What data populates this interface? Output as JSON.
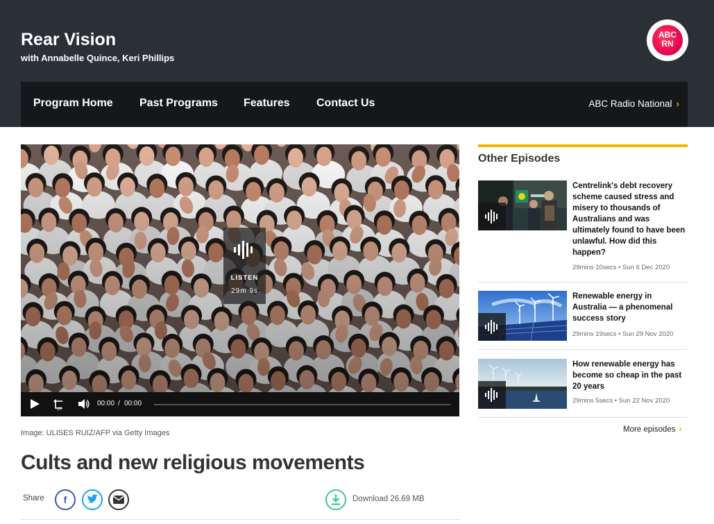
{
  "header": {
    "title": "Rear Vision",
    "hosts": "with Annabelle Quince, Keri Phillips",
    "logo_text": "ABC RN"
  },
  "nav": {
    "items": [
      "Program Home",
      "Past Programs",
      "Features",
      "Contact Us"
    ],
    "network": "ABC Radio National"
  },
  "player": {
    "listen_label": "LISTEN",
    "duration": "29m 9s",
    "current_time": "00:00",
    "separator": "/",
    "total_time": "00:00",
    "progress": 0
  },
  "episode": {
    "image_caption": "Image: ULISES RUIZ/AFP via Getty Images",
    "title": "Cults and new religious movements",
    "share_label": "Share",
    "download_label": "Download 26.69 MB"
  },
  "sidebar": {
    "title": "Other Episodes",
    "episodes": [
      {
        "title": "Centrelink's debt recovery scheme caused stress and misery to thousands of Australians and was ultimately found to have been unlawful. How did this happen?",
        "meta": "29mins 10secs • Sun 6 Dec 2020"
      },
      {
        "title": "Renewable energy in Australia — a phenomenal success story",
        "meta": "29mins 19secs • Sun 29 Nov 2020"
      },
      {
        "title": "How renewable energy has become so cheap in the past 20 years",
        "meta": "29mins 5secs • Sun 22 Nov 2020"
      }
    ],
    "more_label": "More episodes"
  },
  "colors": {
    "header_bg": "#2b2f36",
    "nav_bg": "#15171b",
    "accent_yellow": "#f2b600",
    "download_green": "#3cc39a",
    "facebook": "#3b5998",
    "twitter": "#1da1f2"
  }
}
